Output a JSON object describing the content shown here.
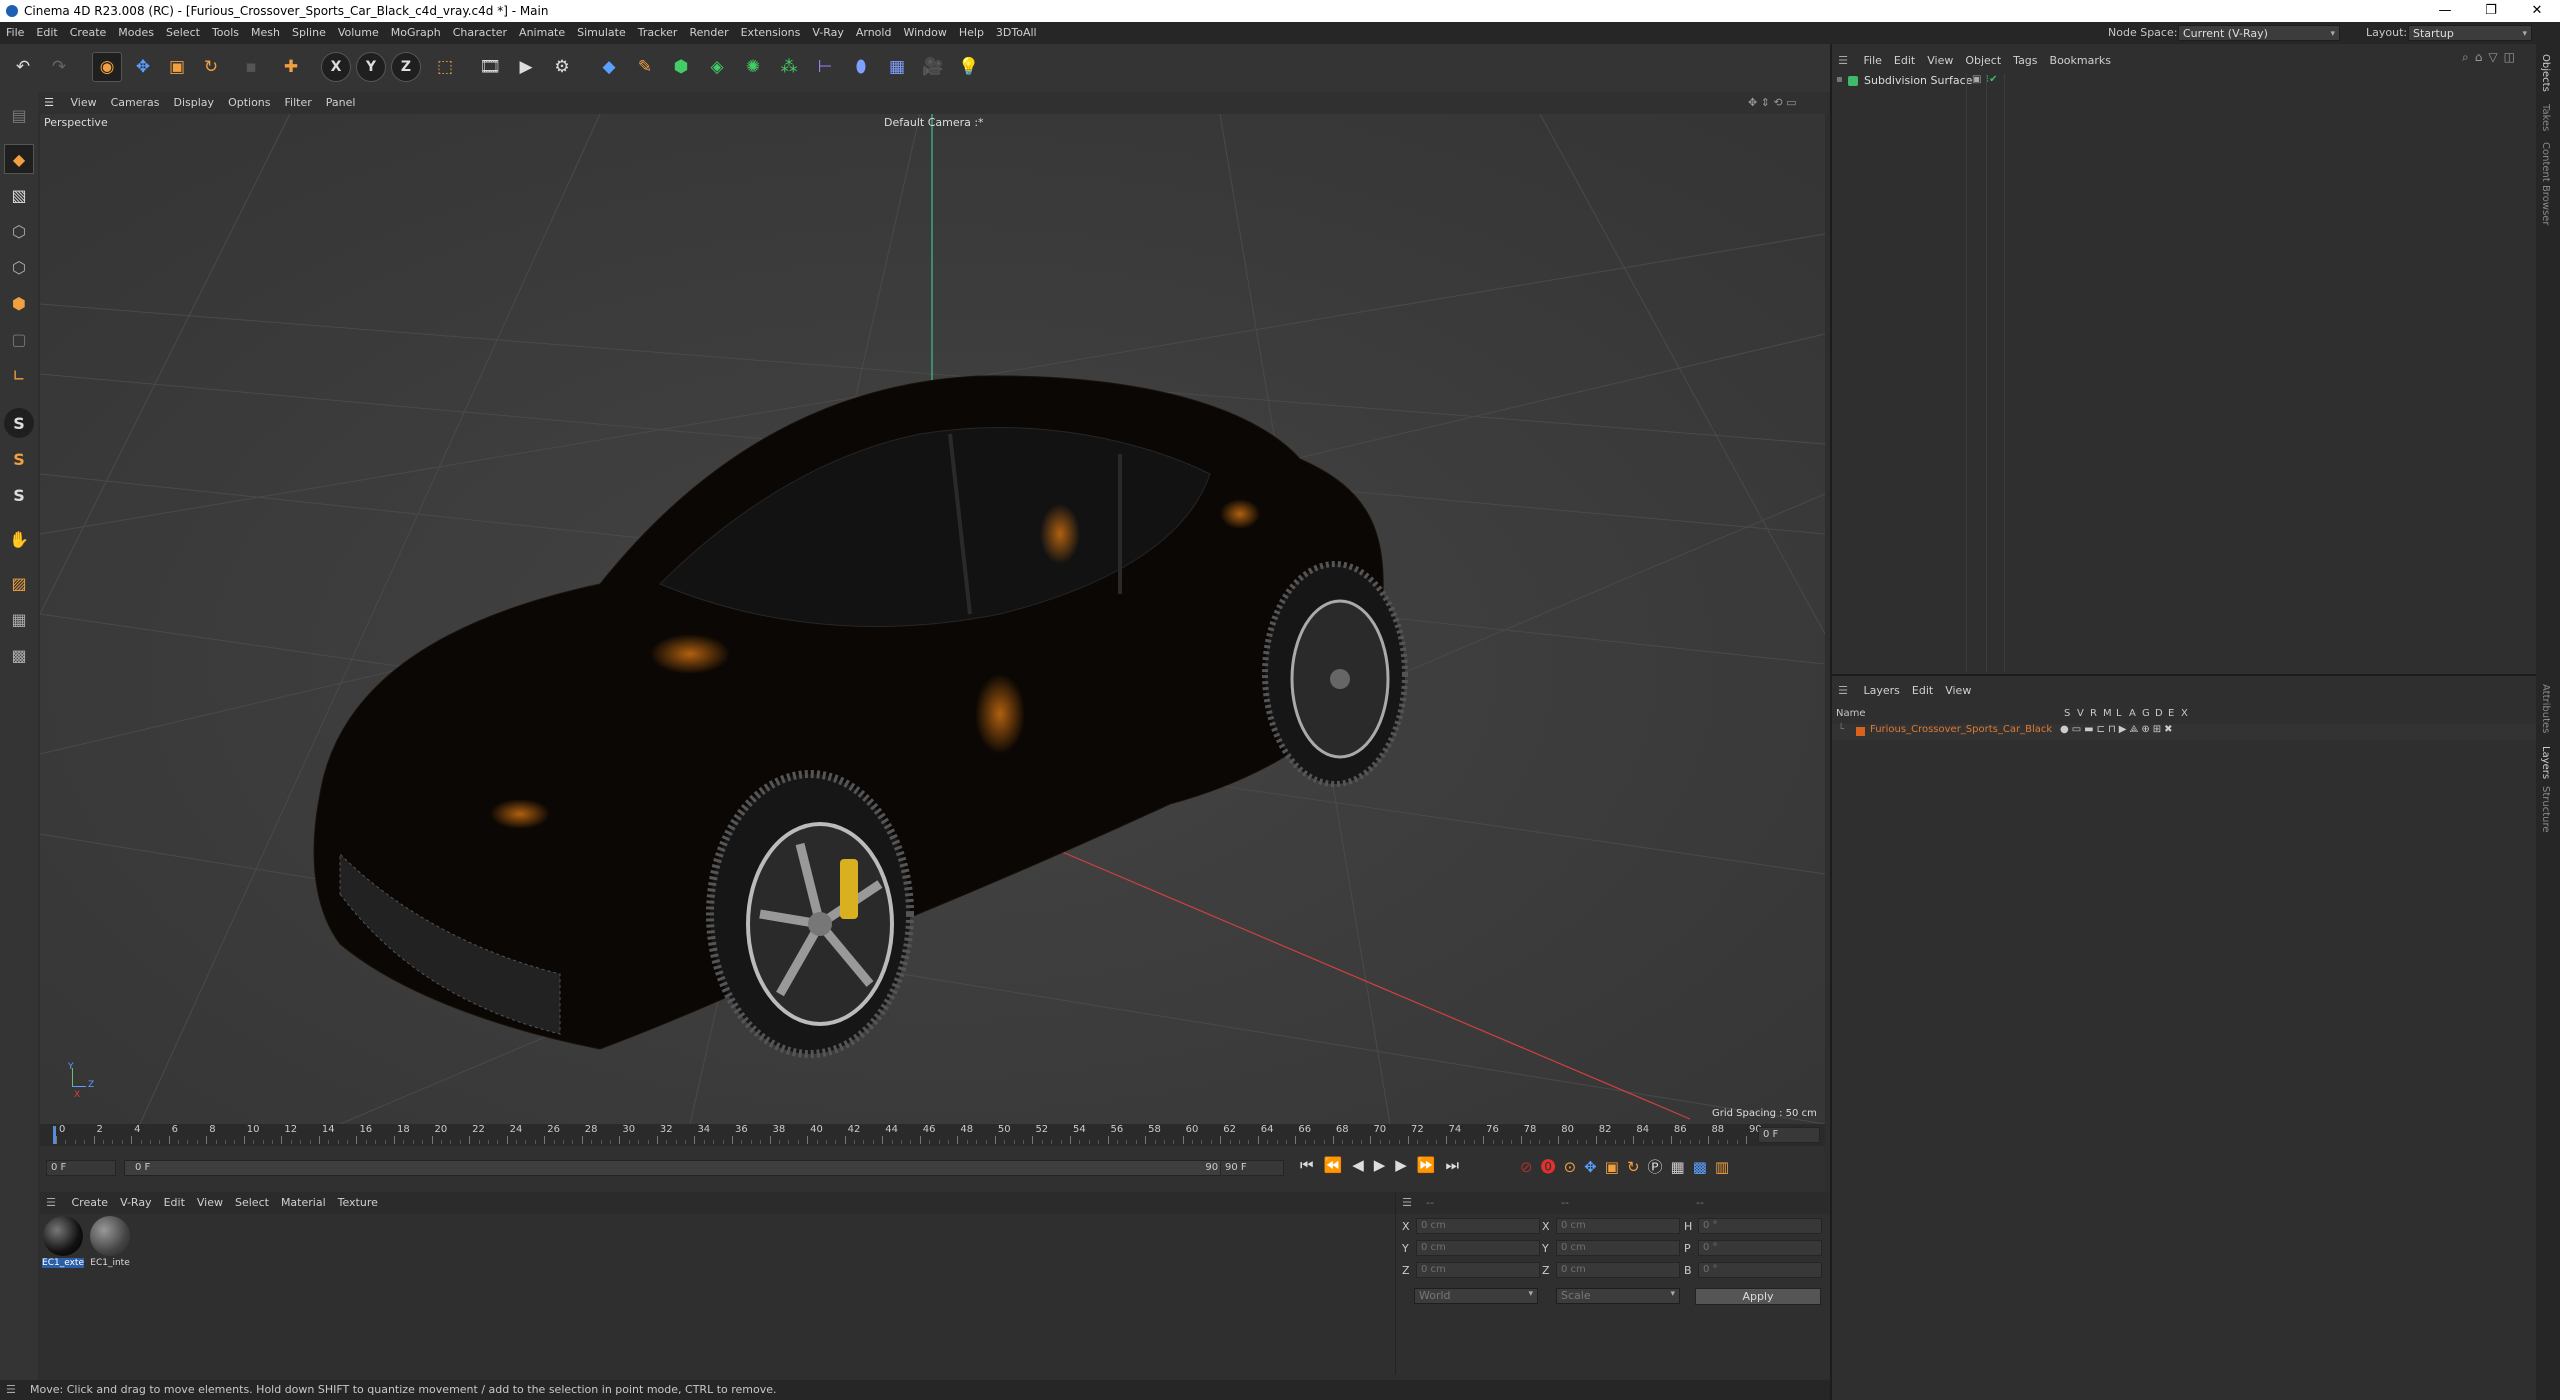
{
  "window": {
    "title": "Cinema 4D R23.008 (RC) - [Furious_Crossover_Sports_Car_Black_c4d_vray.c4d *] - Main",
    "controls": [
      "—",
      "❐",
      "✕"
    ]
  },
  "menubar": {
    "items": [
      "File",
      "Edit",
      "Create",
      "Modes",
      "Select",
      "Tools",
      "Mesh",
      "Spline",
      "Volume",
      "MoGraph",
      "Character",
      "Animate",
      "Simulate",
      "Tracker",
      "Render",
      "Extensions",
      "V-Ray",
      "Arnold",
      "Window",
      "Help",
      "3DToAll"
    ],
    "node_space_label": "Node Space:",
    "node_space_value": "Current (V-Ray)",
    "layout_label": "Layout:",
    "layout_value": "Startup"
  },
  "toolbar": {
    "axis_x": "X",
    "axis_y": "Y",
    "axis_z": "Z"
  },
  "left_tools": {
    "s1": "S",
    "s2": "S",
    "s3": "S"
  },
  "viewport": {
    "menu": [
      "View",
      "Cameras",
      "Display",
      "Options",
      "Filter",
      "Panel"
    ],
    "label": "Perspective",
    "camera": "Default Camera :*",
    "grid_spacing": "Grid Spacing : 50 cm",
    "axis_y": "Y",
    "axis_z": "Z",
    "axis_x": "X"
  },
  "timeline": {
    "ticks": [
      "0",
      "2",
      "4",
      "6",
      "8",
      "10",
      "12",
      "14",
      "16",
      "18",
      "20",
      "22",
      "24",
      "26",
      "28",
      "30",
      "32",
      "34",
      "36",
      "38",
      "40",
      "42",
      "44",
      "46",
      "48",
      "50",
      "52",
      "54",
      "56",
      "58",
      "60",
      "62",
      "64",
      "66",
      "68",
      "70",
      "72",
      "74",
      "76",
      "78",
      "80",
      "82",
      "84",
      "86",
      "88",
      "90"
    ],
    "current_frame": "0 F",
    "start_field": "0 F",
    "range_start": "0 F",
    "range_end": "90 F",
    "end_field": "90 F"
  },
  "materials": {
    "menu": [
      "Create",
      "V-Ray",
      "Edit",
      "View",
      "Select",
      "Material",
      "Texture"
    ],
    "items": [
      {
        "label": "EC1_exte"
      },
      {
        "label": "EC1_inte"
      }
    ]
  },
  "coordinates": {
    "header_1": "--",
    "header_2": "--",
    "header_3": "--",
    "x_label": "X",
    "y_label": "Y",
    "z_label": "Z",
    "x2_label": "X",
    "y2_label": "Y",
    "z2_label": "Z",
    "h_label": "H",
    "p_label": "P",
    "b_label": "B",
    "x_pos": "0 cm",
    "y_pos": "0 cm",
    "z_pos": "0 cm",
    "x_size": "0 cm",
    "y_size": "0 cm",
    "z_size": "0 cm",
    "h_rot": "0 °",
    "p_rot": "0 °",
    "b_rot": "0 °",
    "space": "World",
    "mode": "Scale",
    "apply": "Apply"
  },
  "status": {
    "text": "Move: Click and drag to move elements. Hold down SHIFT to quantize movement / add to the selection in point mode, CTRL to remove."
  },
  "objects_panel": {
    "menu": [
      "File",
      "Edit",
      "View",
      "Object",
      "Tags",
      "Bookmarks"
    ],
    "object_name": "Subdivision Surface"
  },
  "layers_panel": {
    "menu": [
      "Layers",
      "Edit",
      "View"
    ],
    "col_name": "Name",
    "col_flags": [
      "S",
      "V",
      "R",
      "M",
      "L",
      "A",
      "G",
      "D",
      "E",
      "X"
    ],
    "layer_name": "Furious_Crossover_Sports_Car_Black",
    "layer_color": "#d9621c"
  },
  "side_tabs": {
    "top": [
      "Objects",
      "Takes",
      "Content Browser"
    ],
    "bottom": [
      "Attributes",
      "Layers",
      "Structure"
    ]
  }
}
